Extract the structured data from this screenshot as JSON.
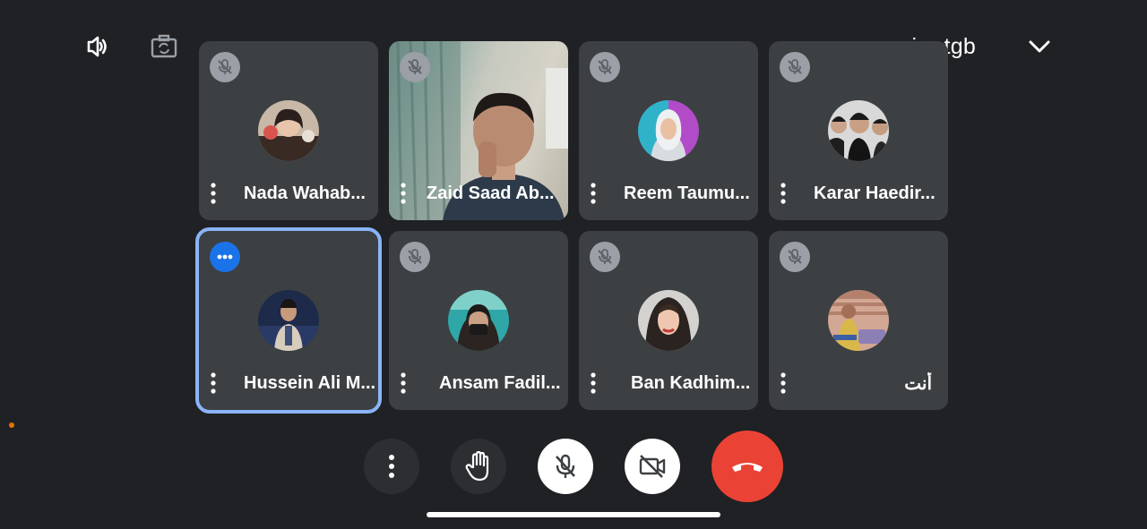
{
  "header": {
    "meeting_code": "xgx-mirz-tgb",
    "icons": [
      "speaker-icon",
      "switch-camera-icon",
      "chevron-left-icon",
      "chevron-down-icon"
    ]
  },
  "participants": [
    {
      "name": "Nada Wahab...",
      "muted": true,
      "video": false
    },
    {
      "name": "Zaid Saad Ab...",
      "muted": true,
      "video": true
    },
    {
      "name": "Reem Taumu...",
      "muted": true,
      "video": false
    },
    {
      "name": "Karar Haedir...",
      "muted": true,
      "video": false
    },
    {
      "name": "Hussein Ali M...",
      "muted": false,
      "video": false,
      "selected": true
    },
    {
      "name": "Ansam Fadil...",
      "muted": true,
      "video": false
    },
    {
      "name": "Ban Kadhim...",
      "muted": true,
      "video": false
    },
    {
      "name": "أنت",
      "muted": true,
      "video": false
    }
  ],
  "controls": [
    "more-options",
    "raise-hand",
    "microphone-off",
    "camera-off",
    "end-call"
  ],
  "colors": {
    "background": "#202124",
    "tile": "#3c4043",
    "selected_outline": "#8ab4f8",
    "end_call": "#ea4335",
    "active_badge": "#1a73e8"
  }
}
